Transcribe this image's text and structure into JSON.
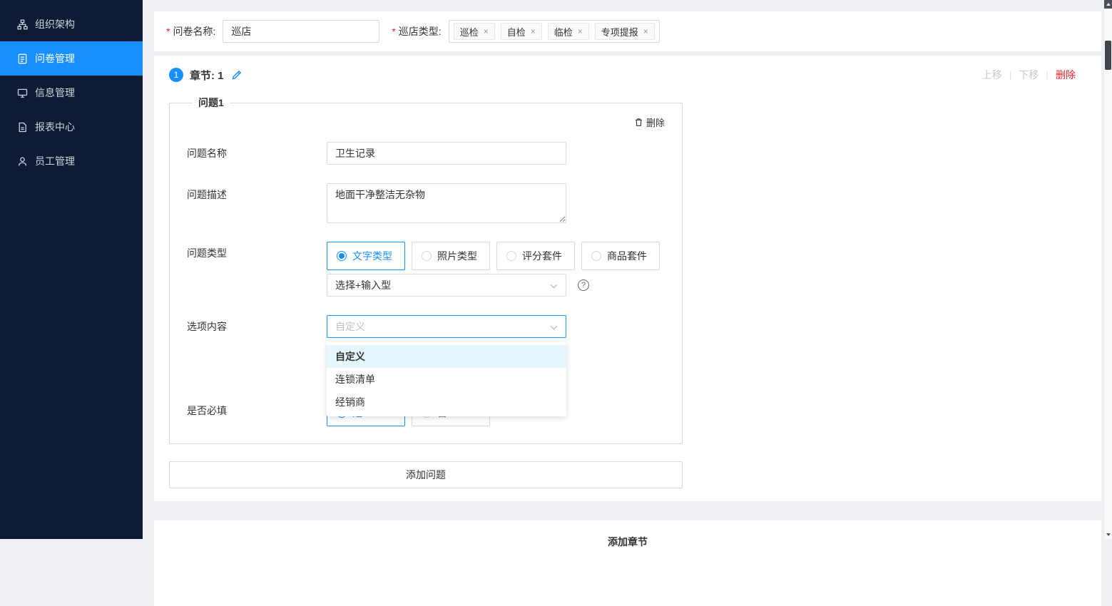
{
  "sidebar": {
    "items": [
      {
        "label": "组织架构"
      },
      {
        "label": "问卷管理"
      },
      {
        "label": "信息管理"
      },
      {
        "label": "报表中心"
      },
      {
        "label": "员工管理"
      }
    ]
  },
  "topbar": {
    "required_mark": "*",
    "name_label": "问卷名称:",
    "name_value": "巡店",
    "type_label": "巡店类型:",
    "tag_close": "×",
    "tags": [
      {
        "label": "巡检"
      },
      {
        "label": "自检"
      },
      {
        "label": "临检"
      },
      {
        "label": "专项提报"
      }
    ]
  },
  "chapter": {
    "badge": "1",
    "title": "章节: 1",
    "actions": {
      "up": "上移",
      "down": "下移",
      "delete": "删除",
      "sep": "|"
    }
  },
  "question": {
    "legend": "问题1",
    "delete_label": "删除",
    "help_icon": "?",
    "fields": {
      "name": {
        "label": "问题名称",
        "value": "卫生记录"
      },
      "desc": {
        "label": "问题描述",
        "value": "地面干净整洁无杂物"
      },
      "type": {
        "label": "问题类型"
      },
      "options": {
        "label": "选项内容",
        "placeholder": "自定义"
      },
      "required": {
        "label": "是否必填"
      }
    },
    "type_options": [
      {
        "label": "文字类型",
        "selected": true
      },
      {
        "label": "照片类型",
        "selected": false
      },
      {
        "label": "评分套件",
        "selected": false
      },
      {
        "label": "商品套件",
        "selected": false
      }
    ],
    "subtype_value": "选择+输入型",
    "dropdown_options": [
      {
        "label": "自定义",
        "active": true
      },
      {
        "label": "连锁清单",
        "active": false
      },
      {
        "label": "经销商",
        "active": false
      }
    ],
    "required_options": [
      {
        "label": "是",
        "selected": true
      },
      {
        "label": "否",
        "selected": false
      }
    ]
  },
  "buttons": {
    "add_question": "添加问题",
    "add_chapter": "添加章节"
  },
  "colors": {
    "accent": "#1890ff",
    "danger": "#f5222d",
    "sidebar_bg": "#0a1b33",
    "selected_option_bg": "#e6f7ff"
  }
}
